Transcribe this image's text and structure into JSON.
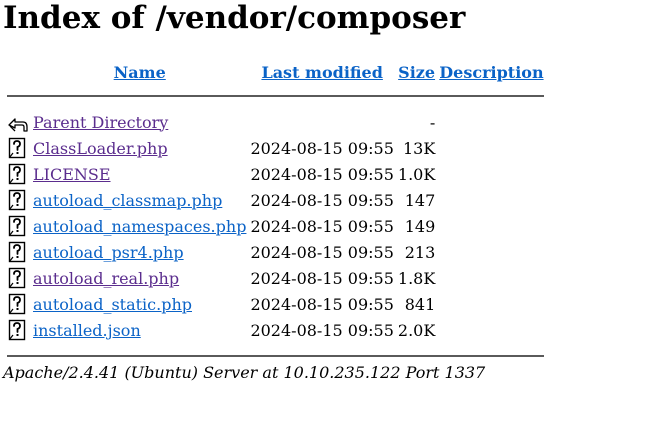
{
  "page": {
    "title": "Index of /vendor/composer"
  },
  "columns": {
    "name": "Name",
    "last_modified": "Last modified",
    "size": "Size",
    "description": "Description"
  },
  "parent": {
    "label": "Parent Directory",
    "size": "-",
    "icon": "back-arrow-icon"
  },
  "entries": [
    {
      "name": "ClassLoader.php",
      "modified": "2024-08-15 09:55",
      "size": "13K",
      "icon": "unknown-file-icon",
      "visited": true
    },
    {
      "name": "LICENSE",
      "modified": "2024-08-15 09:55",
      "size": "1.0K",
      "icon": "unknown-file-icon",
      "visited": true
    },
    {
      "name": "autoload_classmap.php",
      "modified": "2024-08-15 09:55",
      "size": "147",
      "icon": "unknown-file-icon",
      "visited": false
    },
    {
      "name": "autoload_namespaces.php",
      "modified": "2024-08-15 09:55",
      "size": "149",
      "icon": "unknown-file-icon",
      "visited": false
    },
    {
      "name": "autoload_psr4.php",
      "modified": "2024-08-15 09:55",
      "size": "213",
      "icon": "unknown-file-icon",
      "visited": false
    },
    {
      "name": "autoload_real.php",
      "modified": "2024-08-15 09:55",
      "size": "1.8K",
      "icon": "unknown-file-icon",
      "visited": true
    },
    {
      "name": "autoload_static.php",
      "modified": "2024-08-15 09:55",
      "size": "841",
      "icon": "unknown-file-icon",
      "visited": false
    },
    {
      "name": "installed.json",
      "modified": "2024-08-15 09:55",
      "size": "2.0K",
      "icon": "unknown-file-icon",
      "visited": false
    }
  ],
  "footer": {
    "address": "Apache/2.4.41 (Ubuntu) Server at 10.10.235.122 Port 1337"
  },
  "colors": {
    "link": "#0b63c7",
    "visited_link": "#5b2d8e",
    "rule": "#5a5a5a"
  }
}
